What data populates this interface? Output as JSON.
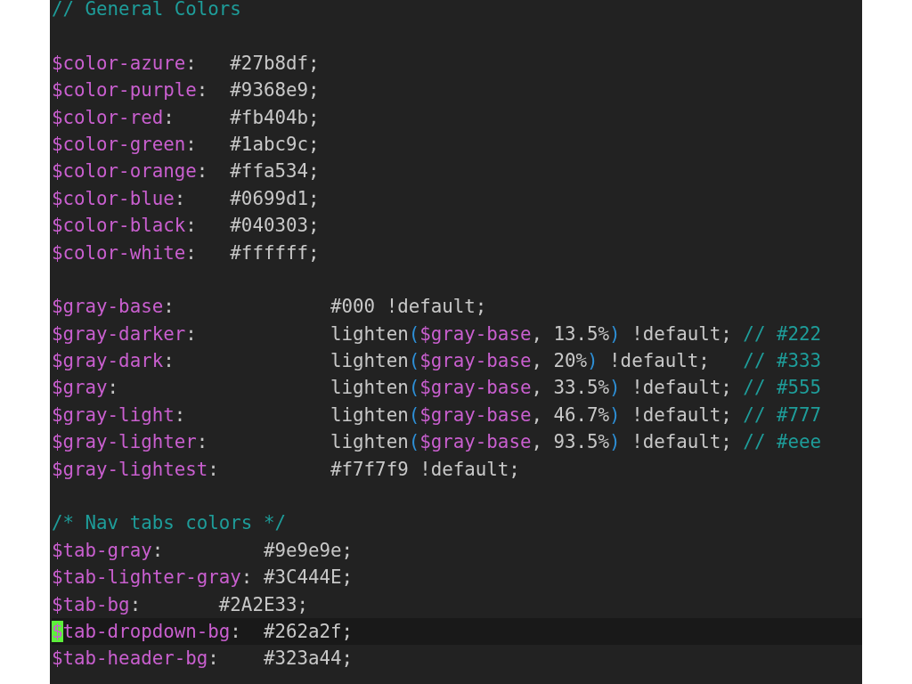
{
  "editor": {
    "lines": [
      {
        "kind": "code",
        "current": false,
        "tokens": [
          {
            "kind": "comment",
            "text": "// General Colors"
          }
        ]
      },
      {
        "kind": "blank",
        "current": false
      },
      {
        "kind": "code",
        "current": false,
        "tokens": [
          {
            "kind": "var",
            "text": "$color-azure"
          },
          {
            "kind": "punct",
            "text": ":"
          },
          {
            "kind": "value",
            "text": "   #27b8df;"
          }
        ]
      },
      {
        "kind": "code",
        "current": false,
        "tokens": [
          {
            "kind": "var",
            "text": "$color-purple"
          },
          {
            "kind": "punct",
            "text": ":"
          },
          {
            "kind": "value",
            "text": "  #9368e9;"
          }
        ]
      },
      {
        "kind": "code",
        "current": false,
        "tokens": [
          {
            "kind": "var",
            "text": "$color-red"
          },
          {
            "kind": "punct",
            "text": ":"
          },
          {
            "kind": "value",
            "text": "     #fb404b;"
          }
        ]
      },
      {
        "kind": "code",
        "current": false,
        "tokens": [
          {
            "kind": "var",
            "text": "$color-green"
          },
          {
            "kind": "punct",
            "text": ":"
          },
          {
            "kind": "value",
            "text": "   #1abc9c;"
          }
        ]
      },
      {
        "kind": "code",
        "current": false,
        "tokens": [
          {
            "kind": "var",
            "text": "$color-orange"
          },
          {
            "kind": "punct",
            "text": ":"
          },
          {
            "kind": "value",
            "text": "  #ffa534;"
          }
        ]
      },
      {
        "kind": "code",
        "current": false,
        "tokens": [
          {
            "kind": "var",
            "text": "$color-blue"
          },
          {
            "kind": "punct",
            "text": ":"
          },
          {
            "kind": "value",
            "text": "    #0699d1;"
          }
        ]
      },
      {
        "kind": "code",
        "current": false,
        "tokens": [
          {
            "kind": "var",
            "text": "$color-black"
          },
          {
            "kind": "punct",
            "text": ":"
          },
          {
            "kind": "value",
            "text": "   #040303;"
          }
        ]
      },
      {
        "kind": "code",
        "current": false,
        "tokens": [
          {
            "kind": "var",
            "text": "$color-white"
          },
          {
            "kind": "punct",
            "text": ":"
          },
          {
            "kind": "value",
            "text": "   #ffffff;"
          }
        ]
      },
      {
        "kind": "blank",
        "current": false
      },
      {
        "kind": "code",
        "current": false,
        "tokens": [
          {
            "kind": "var",
            "text": "$gray-base"
          },
          {
            "kind": "punct",
            "text": ":"
          },
          {
            "kind": "value",
            "text": "              #000 !default;"
          }
        ]
      },
      {
        "kind": "code",
        "current": false,
        "tokens": [
          {
            "kind": "var",
            "text": "$gray-darker"
          },
          {
            "kind": "punct",
            "text": ":"
          },
          {
            "kind": "value",
            "text": "            lighten"
          },
          {
            "kind": "paren",
            "text": "("
          },
          {
            "kind": "var",
            "text": "$gray-base"
          },
          {
            "kind": "value",
            "text": ", 13.5%"
          },
          {
            "kind": "paren",
            "text": ")"
          },
          {
            "kind": "value",
            "text": " !default;"
          },
          {
            "kind": "comment",
            "text": " // #222"
          }
        ]
      },
      {
        "kind": "code",
        "current": false,
        "tokens": [
          {
            "kind": "var",
            "text": "$gray-dark"
          },
          {
            "kind": "punct",
            "text": ":"
          },
          {
            "kind": "value",
            "text": "              lighten"
          },
          {
            "kind": "paren",
            "text": "("
          },
          {
            "kind": "var",
            "text": "$gray-base"
          },
          {
            "kind": "value",
            "text": ", 20%"
          },
          {
            "kind": "paren",
            "text": ")"
          },
          {
            "kind": "value",
            "text": " !default;"
          },
          {
            "kind": "comment",
            "text": "   // #333"
          }
        ]
      },
      {
        "kind": "code",
        "current": false,
        "tokens": [
          {
            "kind": "var",
            "text": "$gray"
          },
          {
            "kind": "punct",
            "text": ":"
          },
          {
            "kind": "value",
            "text": "                   lighten"
          },
          {
            "kind": "paren",
            "text": "("
          },
          {
            "kind": "var",
            "text": "$gray-base"
          },
          {
            "kind": "value",
            "text": ", 33.5%"
          },
          {
            "kind": "paren",
            "text": ")"
          },
          {
            "kind": "value",
            "text": " !default;"
          },
          {
            "kind": "comment",
            "text": " // #555"
          }
        ]
      },
      {
        "kind": "code",
        "current": false,
        "tokens": [
          {
            "kind": "var",
            "text": "$gray-light"
          },
          {
            "kind": "punct",
            "text": ":"
          },
          {
            "kind": "value",
            "text": "             lighten"
          },
          {
            "kind": "paren",
            "text": "("
          },
          {
            "kind": "var",
            "text": "$gray-base"
          },
          {
            "kind": "value",
            "text": ", 46.7%"
          },
          {
            "kind": "paren",
            "text": ")"
          },
          {
            "kind": "value",
            "text": " !default;"
          },
          {
            "kind": "comment",
            "text": " // #777"
          }
        ]
      },
      {
        "kind": "code",
        "current": false,
        "tokens": [
          {
            "kind": "var",
            "text": "$gray-lighter"
          },
          {
            "kind": "punct",
            "text": ":"
          },
          {
            "kind": "value",
            "text": "           lighten"
          },
          {
            "kind": "paren",
            "text": "("
          },
          {
            "kind": "var",
            "text": "$gray-base"
          },
          {
            "kind": "value",
            "text": ", 93.5%"
          },
          {
            "kind": "paren",
            "text": ")"
          },
          {
            "kind": "value",
            "text": " !default;"
          },
          {
            "kind": "comment",
            "text": " // #eee"
          }
        ]
      },
      {
        "kind": "code",
        "current": false,
        "tokens": [
          {
            "kind": "var",
            "text": "$gray-lightest"
          },
          {
            "kind": "punct",
            "text": ":"
          },
          {
            "kind": "value",
            "text": "          #f7f7f9 !default;"
          }
        ]
      },
      {
        "kind": "blank",
        "current": false
      },
      {
        "kind": "code",
        "current": false,
        "tokens": [
          {
            "kind": "comment",
            "text": "/* Nav tabs colors */"
          }
        ]
      },
      {
        "kind": "code",
        "current": false,
        "tokens": [
          {
            "kind": "var",
            "text": "$tab-gray"
          },
          {
            "kind": "punct",
            "text": ":"
          },
          {
            "kind": "value",
            "text": "         #9e9e9e;"
          }
        ]
      },
      {
        "kind": "code",
        "current": false,
        "tokens": [
          {
            "kind": "var",
            "text": "$tab-lighter-gray"
          },
          {
            "kind": "punct",
            "text": ":"
          },
          {
            "kind": "value",
            "text": " #3C444E;"
          }
        ]
      },
      {
        "kind": "code",
        "current": false,
        "tokens": [
          {
            "kind": "var",
            "text": "$tab-bg"
          },
          {
            "kind": "punct",
            "text": ":"
          },
          {
            "kind": "value",
            "text": "       #2A2E33;"
          }
        ]
      },
      {
        "kind": "code",
        "current": true,
        "tokens": [
          {
            "kind": "var",
            "text": "$tab-dropdown-bg"
          },
          {
            "kind": "punct",
            "text": ":"
          },
          {
            "kind": "value",
            "text": "  #262a2f;"
          }
        ]
      },
      {
        "kind": "code",
        "current": false,
        "tokens": [
          {
            "kind": "var",
            "text": "$tab-header-bg"
          },
          {
            "kind": "punct",
            "text": ":"
          },
          {
            "kind": "value",
            "text": "    #323a44;"
          }
        ]
      }
    ]
  }
}
